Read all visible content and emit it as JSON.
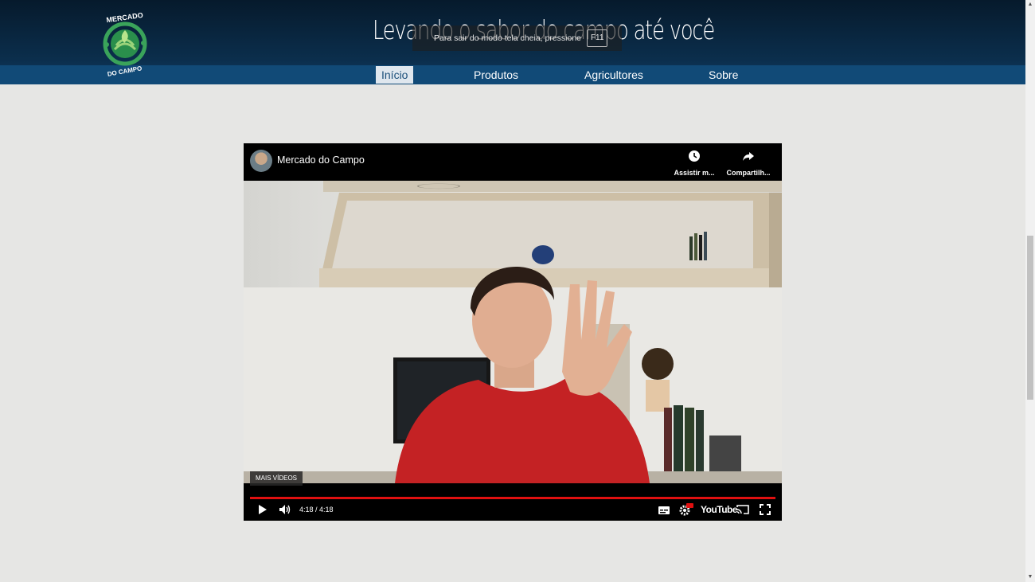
{
  "header": {
    "slogan": "Levando o sabor do campo até você",
    "logo_text_top": "MERCADO",
    "logo_text_bottom": "DO CAMPO",
    "fullscreen_toast": "Para sair do modo tela cheia, pressione",
    "fullscreen_key": "F11"
  },
  "nav": {
    "items": [
      {
        "label": "Início",
        "active": true
      },
      {
        "label": "Produtos",
        "active": false
      },
      {
        "label": "Agricultores",
        "active": false
      },
      {
        "label": "Sobre",
        "active": false
      }
    ]
  },
  "video": {
    "channel": "Mercado do Campo",
    "watch_later": "Assistir m...",
    "share": "Compartilh...",
    "more_videos": "MAIS VÍDEOS",
    "time": "4:18 / 4:18",
    "progress": 1.0,
    "brand": "YouTube",
    "hd_badge": "HD"
  },
  "colors": {
    "header_dark": "#061a2c",
    "navbar": "#114a77",
    "page_bg": "#e6e6e4",
    "progress": "#e01010",
    "logo_green": "#3aa35a"
  }
}
